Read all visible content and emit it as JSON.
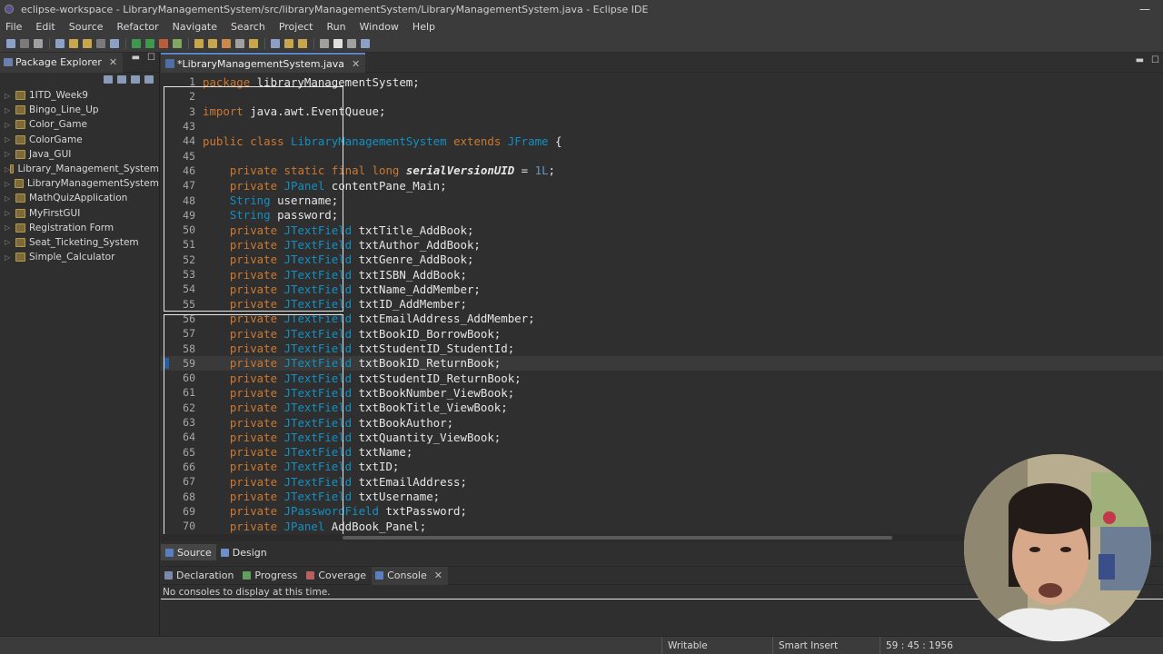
{
  "window": {
    "title": "eclipse-workspace - LibraryManagementSystem/src/libraryManagementSystem/LibraryManagementSystem.java - Eclipse IDE",
    "controls": [
      "—",
      "☐",
      "✕"
    ]
  },
  "menu": [
    "File",
    "Edit",
    "Source",
    "Refactor",
    "Navigate",
    "Search",
    "Project",
    "Run",
    "Window",
    "Help"
  ],
  "package_explorer": {
    "title": "Package Explorer",
    "close": "✕",
    "projects": [
      "1ITD_Week9",
      "Bingo_Line_Up",
      "Color_Game",
      "ColorGame",
      "Java_GUI",
      "Library_Management_System",
      "LibraryManagementSystem",
      "MathQuizApplication",
      "MyFirstGUI",
      "Registration Form",
      "Seat_Ticketing_System",
      "Simple_Calculator"
    ]
  },
  "editor": {
    "tab_label": "*LibraryManagementSystem.java",
    "tab_close": "✕",
    "current_line": "59",
    "lines": [
      {
        "n": "1",
        "code": "package libraryManagementSystem;"
      },
      {
        "n": "2",
        "code": ""
      },
      {
        "n": "3",
        "code": "import java.awt.EventQueue;"
      },
      {
        "n": "43",
        "code": ""
      },
      {
        "n": "44",
        "code": "public class LibraryManagementSystem extends JFrame {"
      },
      {
        "n": "45",
        "code": ""
      },
      {
        "n": "46",
        "code": "    private static final long serialVersionUID = 1L;"
      },
      {
        "n": "47",
        "code": "    private JPanel contentPane_Main;"
      },
      {
        "n": "48",
        "code": "    String username;"
      },
      {
        "n": "49",
        "code": "    String password;"
      },
      {
        "n": "50",
        "code": "    private JTextField txtTitle_AddBook;"
      },
      {
        "n": "51",
        "code": "    private JTextField txtAuthor_AddBook;"
      },
      {
        "n": "52",
        "code": "    private JTextField txtGenre_AddBook;"
      },
      {
        "n": "53",
        "code": "    private JTextField txtISBN_AddBook;"
      },
      {
        "n": "54",
        "code": "    private JTextField txtName_AddMember;"
      },
      {
        "n": "55",
        "code": "    private JTextField txtID_AddMember;"
      },
      {
        "n": "56",
        "code": "    private JTextField txtEmailAddress_AddMember;"
      },
      {
        "n": "57",
        "code": "    private JTextField txtBookID_BorrowBook;"
      },
      {
        "n": "58",
        "code": "    private JTextField txtStudentID_StudentId;"
      },
      {
        "n": "59",
        "code": "    private JTextField txtBookID_ReturnBook;"
      },
      {
        "n": "60",
        "code": "    private JTextField txtStudentID_ReturnBook;"
      },
      {
        "n": "61",
        "code": "    private JTextField txtBookNumber_ViewBook;"
      },
      {
        "n": "62",
        "code": "    private JTextField txtBookTitle_ViewBook;"
      },
      {
        "n": "63",
        "code": "    private JTextField txtBookAuthor;"
      },
      {
        "n": "64",
        "code": "    private JTextField txtQuantity_ViewBook;"
      },
      {
        "n": "65",
        "code": "    private JTextField txtName;"
      },
      {
        "n": "66",
        "code": "    private JTextField txtID;"
      },
      {
        "n": "67",
        "code": "    private JTextField txtEmailAddress;"
      },
      {
        "n": "68",
        "code": "    private JTextField txtUsername;"
      },
      {
        "n": "69",
        "code": "    private JPasswordField txtPassword;"
      },
      {
        "n": "70",
        "code": "    private JPanel AddBook_Panel;"
      }
    ],
    "bottom_tabs": [
      "Source",
      "Design"
    ]
  },
  "console": {
    "tabs": [
      "Declaration",
      "Progress",
      "Coverage",
      "Console"
    ],
    "active": "Console",
    "close": "✕",
    "message": "No consoles to display at this time."
  },
  "status": {
    "writable": "Writable",
    "insert_mode": "Smart Insert",
    "position": "59 : 45 : 1956"
  },
  "colors": {
    "keyword": "#cc7832",
    "type": "#1290c3",
    "number": "#6897bb",
    "background": "#2f2f2f",
    "accent": "#5c86c4"
  }
}
